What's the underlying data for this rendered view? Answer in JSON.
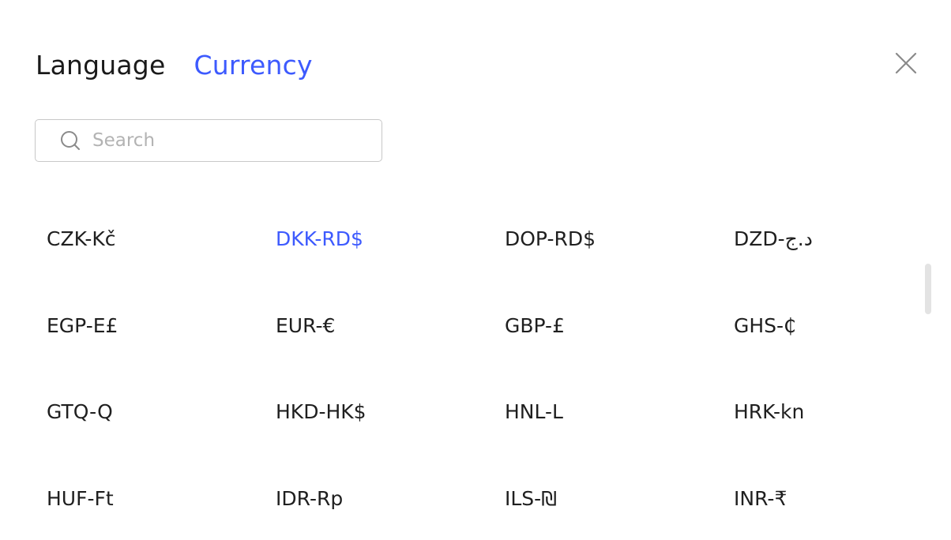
{
  "tabs": {
    "language": "Language",
    "currency": "Currency",
    "active": "currency"
  },
  "search": {
    "placeholder": "Search",
    "value": ""
  },
  "currencies": [
    "CZK-Kč",
    "DKK-RD$",
    "DOP-RD$",
    "DZD-د.ج",
    "EGP-E£",
    "EUR-€",
    "GBP-£",
    "GHS-₵",
    "GTQ-Q",
    "HKD-HK$",
    "HNL-L",
    "HRK-kn",
    "HUF-Ft",
    "IDR-Rp",
    "ILS-₪",
    "INR-₹"
  ],
  "selected_currency": "DKK-RD$",
  "icons": {
    "close": "close-icon",
    "search": "search-icon"
  },
  "colors": {
    "accent": "#3d5afe",
    "text": "#1f1f1f",
    "placeholder": "#b3b3b3",
    "border": "#c8c8c8"
  }
}
